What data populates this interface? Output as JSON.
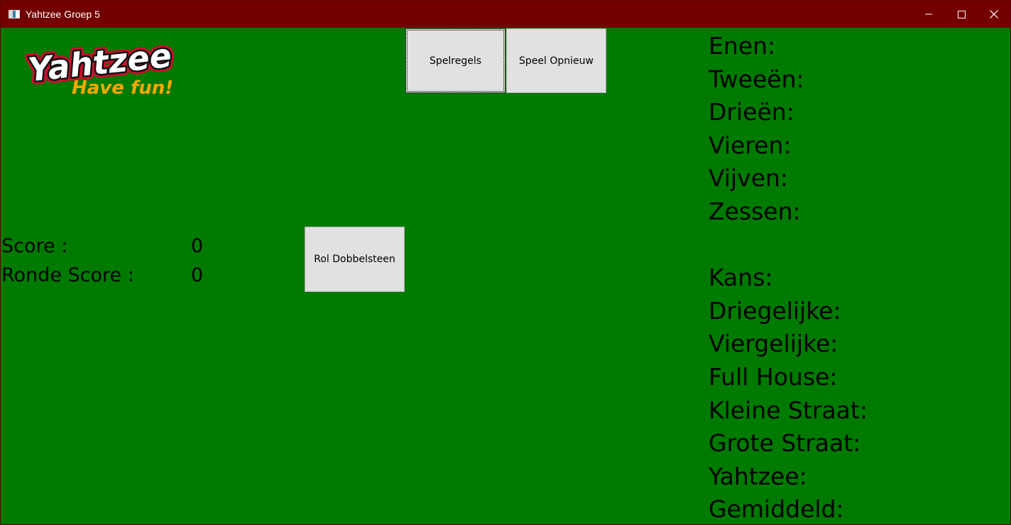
{
  "window": {
    "title": "Yahtzee Groep 5",
    "titlebar_color": "#730000",
    "background_color": "#007a00",
    "controls": {
      "minimize_icon": "minimize-icon",
      "maximize_icon": "maximize-icon",
      "close_icon": "close-icon"
    }
  },
  "logo": {
    "brand_text": "Yahtzee",
    "tagline": "Have fun!",
    "tagline_color": "#f5a800"
  },
  "toolbar": {
    "rules_label": "Spelregels",
    "replay_label": "Speel Opnieuw"
  },
  "game": {
    "roll_label": "Rol Dobbelsteen",
    "score_label": "Score :",
    "score_value": "0",
    "round_score_label": "Ronde Score :",
    "round_score_value": "0"
  },
  "scorecard": {
    "upper": [
      "Enen:",
      "Tweeën:",
      "Drieën:",
      "Vieren:",
      "Vijven:",
      "Zessen:"
    ],
    "lower": [
      "Kans:",
      "Driegelijke:",
      "Viergelijke:",
      "Full House:",
      "Kleine Straat:",
      "Grote Straat:",
      "Yahtzee:",
      "Gemiddeld:"
    ]
  }
}
